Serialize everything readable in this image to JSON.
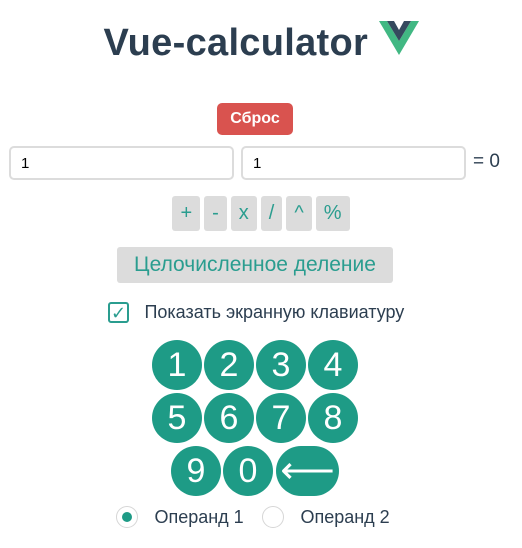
{
  "header": {
    "title": "Vue-calculator",
    "logo_icon": "vue-logo-icon"
  },
  "reset_button": {
    "label": "Сброс",
    "color": "#d9534f"
  },
  "operands": {
    "operand_1_value": "1",
    "operand_2_value": "1"
  },
  "result_text": "= 0",
  "operations": [
    "+",
    "-",
    "x",
    "/",
    "^",
    "%"
  ],
  "integer_division_label": "Целочисленное деление",
  "keyboard_toggle": {
    "label": "Показать экранную клавиатуру",
    "checked": true,
    "check_glyph": "✓"
  },
  "keypad": {
    "keys": [
      "1",
      "2",
      "3",
      "4",
      "5",
      "6",
      "7",
      "8",
      "9",
      "0"
    ],
    "backspace_glyph": "⟵",
    "color": "#1e9b86"
  },
  "operand_select": {
    "options": [
      "Операнд 1",
      "Операнд 2"
    ],
    "selected": "Операнд 1"
  },
  "colors": {
    "accent": "#2a9d8f",
    "title": "#2c3e50"
  }
}
